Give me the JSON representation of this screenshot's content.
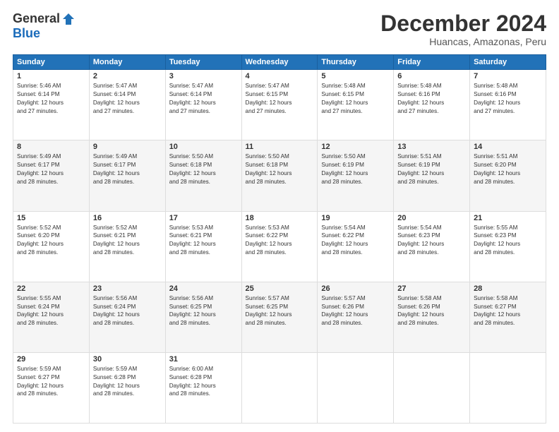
{
  "header": {
    "logo_general": "General",
    "logo_blue": "Blue",
    "title": "December 2024",
    "subtitle": "Huancas, Amazonas, Peru"
  },
  "days_of_week": [
    "Sunday",
    "Monday",
    "Tuesday",
    "Wednesday",
    "Thursday",
    "Friday",
    "Saturday"
  ],
  "weeks": [
    [
      {
        "day": 1,
        "lines": [
          "Sunrise: 5:46 AM",
          "Sunset: 6:14 PM",
          "Daylight: 12 hours",
          "and 27 minutes."
        ]
      },
      {
        "day": 2,
        "lines": [
          "Sunrise: 5:47 AM",
          "Sunset: 6:14 PM",
          "Daylight: 12 hours",
          "and 27 minutes."
        ]
      },
      {
        "day": 3,
        "lines": [
          "Sunrise: 5:47 AM",
          "Sunset: 6:14 PM",
          "Daylight: 12 hours",
          "and 27 minutes."
        ]
      },
      {
        "day": 4,
        "lines": [
          "Sunrise: 5:47 AM",
          "Sunset: 6:15 PM",
          "Daylight: 12 hours",
          "and 27 minutes."
        ]
      },
      {
        "day": 5,
        "lines": [
          "Sunrise: 5:48 AM",
          "Sunset: 6:15 PM",
          "Daylight: 12 hours",
          "and 27 minutes."
        ]
      },
      {
        "day": 6,
        "lines": [
          "Sunrise: 5:48 AM",
          "Sunset: 6:16 PM",
          "Daylight: 12 hours",
          "and 27 minutes."
        ]
      },
      {
        "day": 7,
        "lines": [
          "Sunrise: 5:48 AM",
          "Sunset: 6:16 PM",
          "Daylight: 12 hours",
          "and 27 minutes."
        ]
      }
    ],
    [
      {
        "day": 8,
        "lines": [
          "Sunrise: 5:49 AM",
          "Sunset: 6:17 PM",
          "Daylight: 12 hours",
          "and 28 minutes."
        ]
      },
      {
        "day": 9,
        "lines": [
          "Sunrise: 5:49 AM",
          "Sunset: 6:17 PM",
          "Daylight: 12 hours",
          "and 28 minutes."
        ]
      },
      {
        "day": 10,
        "lines": [
          "Sunrise: 5:50 AM",
          "Sunset: 6:18 PM",
          "Daylight: 12 hours",
          "and 28 minutes."
        ]
      },
      {
        "day": 11,
        "lines": [
          "Sunrise: 5:50 AM",
          "Sunset: 6:18 PM",
          "Daylight: 12 hours",
          "and 28 minutes."
        ]
      },
      {
        "day": 12,
        "lines": [
          "Sunrise: 5:50 AM",
          "Sunset: 6:19 PM",
          "Daylight: 12 hours",
          "and 28 minutes."
        ]
      },
      {
        "day": 13,
        "lines": [
          "Sunrise: 5:51 AM",
          "Sunset: 6:19 PM",
          "Daylight: 12 hours",
          "and 28 minutes."
        ]
      },
      {
        "day": 14,
        "lines": [
          "Sunrise: 5:51 AM",
          "Sunset: 6:20 PM",
          "Daylight: 12 hours",
          "and 28 minutes."
        ]
      }
    ],
    [
      {
        "day": 15,
        "lines": [
          "Sunrise: 5:52 AM",
          "Sunset: 6:20 PM",
          "Daylight: 12 hours",
          "and 28 minutes."
        ]
      },
      {
        "day": 16,
        "lines": [
          "Sunrise: 5:52 AM",
          "Sunset: 6:21 PM",
          "Daylight: 12 hours",
          "and 28 minutes."
        ]
      },
      {
        "day": 17,
        "lines": [
          "Sunrise: 5:53 AM",
          "Sunset: 6:21 PM",
          "Daylight: 12 hours",
          "and 28 minutes."
        ]
      },
      {
        "day": 18,
        "lines": [
          "Sunrise: 5:53 AM",
          "Sunset: 6:22 PM",
          "Daylight: 12 hours",
          "and 28 minutes."
        ]
      },
      {
        "day": 19,
        "lines": [
          "Sunrise: 5:54 AM",
          "Sunset: 6:22 PM",
          "Daylight: 12 hours",
          "and 28 minutes."
        ]
      },
      {
        "day": 20,
        "lines": [
          "Sunrise: 5:54 AM",
          "Sunset: 6:23 PM",
          "Daylight: 12 hours",
          "and 28 minutes."
        ]
      },
      {
        "day": 21,
        "lines": [
          "Sunrise: 5:55 AM",
          "Sunset: 6:23 PM",
          "Daylight: 12 hours",
          "and 28 minutes."
        ]
      }
    ],
    [
      {
        "day": 22,
        "lines": [
          "Sunrise: 5:55 AM",
          "Sunset: 6:24 PM",
          "Daylight: 12 hours",
          "and 28 minutes."
        ]
      },
      {
        "day": 23,
        "lines": [
          "Sunrise: 5:56 AM",
          "Sunset: 6:24 PM",
          "Daylight: 12 hours",
          "and 28 minutes."
        ]
      },
      {
        "day": 24,
        "lines": [
          "Sunrise: 5:56 AM",
          "Sunset: 6:25 PM",
          "Daylight: 12 hours",
          "and 28 minutes."
        ]
      },
      {
        "day": 25,
        "lines": [
          "Sunrise: 5:57 AM",
          "Sunset: 6:25 PM",
          "Daylight: 12 hours",
          "and 28 minutes."
        ]
      },
      {
        "day": 26,
        "lines": [
          "Sunrise: 5:57 AM",
          "Sunset: 6:26 PM",
          "Daylight: 12 hours",
          "and 28 minutes."
        ]
      },
      {
        "day": 27,
        "lines": [
          "Sunrise: 5:58 AM",
          "Sunset: 6:26 PM",
          "Daylight: 12 hours",
          "and 28 minutes."
        ]
      },
      {
        "day": 28,
        "lines": [
          "Sunrise: 5:58 AM",
          "Sunset: 6:27 PM",
          "Daylight: 12 hours",
          "and 28 minutes."
        ]
      }
    ],
    [
      {
        "day": 29,
        "lines": [
          "Sunrise: 5:59 AM",
          "Sunset: 6:27 PM",
          "Daylight: 12 hours",
          "and 28 minutes."
        ]
      },
      {
        "day": 30,
        "lines": [
          "Sunrise: 5:59 AM",
          "Sunset: 6:28 PM",
          "Daylight: 12 hours",
          "and 28 minutes."
        ]
      },
      {
        "day": 31,
        "lines": [
          "Sunrise: 6:00 AM",
          "Sunset: 6:28 PM",
          "Daylight: 12 hours",
          "and 28 minutes."
        ]
      },
      null,
      null,
      null,
      null
    ]
  ]
}
